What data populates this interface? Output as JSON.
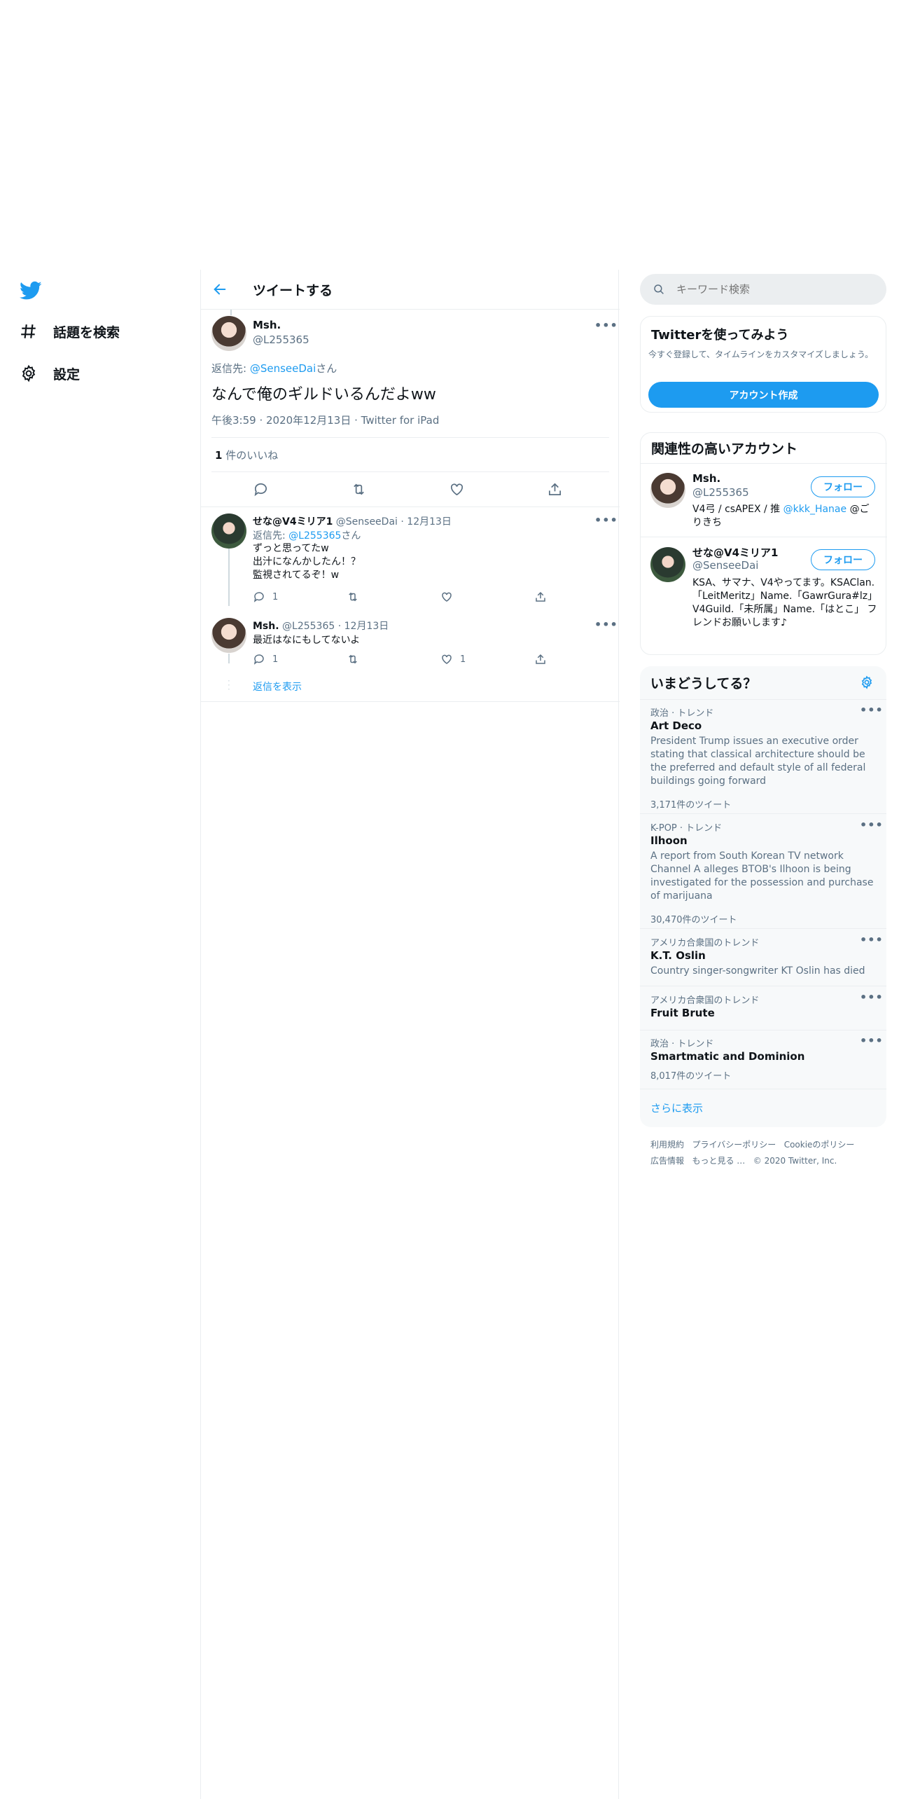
{
  "nav": {
    "items": [
      {
        "label": "話題を検索",
        "icon": "hashtag-icon"
      },
      {
        "label": "設定",
        "icon": "gear-icon"
      }
    ]
  },
  "header": {
    "title": "ツイートする"
  },
  "main_tweet": {
    "name": "Msh.",
    "handle": "@L255365",
    "reply_prefix": "返信先: ",
    "reply_to": "@SenseeDai",
    "reply_suffix": "さん",
    "text": "なんで俺のギルドいるんだよww",
    "time": "午後3:59",
    "date": "2020年12月13日",
    "source": "Twitter for iPad",
    "likes_count": "1",
    "likes_label": "件のいいね"
  },
  "replies": [
    {
      "name": "せな@V4ミリア1",
      "handle": "@SenseeDai",
      "date": "12月13日",
      "reply_prefix": "返信先: ",
      "reply_to": "@L255365",
      "reply_suffix": "さん",
      "lines": [
        "ずっと思ってたw",
        "出汁になんかしたん！？",
        "監視されてるぞ！w"
      ],
      "reply_count": "1",
      "like_count": ""
    },
    {
      "name": "Msh.",
      "handle": "@L255365",
      "date": "12月13日",
      "lines": [
        "最近はなにもしてないよ"
      ],
      "reply_count": "1",
      "like_count": "1"
    }
  ],
  "show_replies": "返信を表示",
  "search": {
    "placeholder": "キーワード検索"
  },
  "signup": {
    "title": "Twitterを使ってみよう",
    "subtitle": "今すぐ登録して、タイムラインをカスタマイズしましょう。",
    "button": "アカウント作成"
  },
  "related": {
    "title": "関連性の高いアカウント",
    "accounts": [
      {
        "name": "Msh.",
        "handle": "@L255365",
        "follow": "フォロー",
        "bio_a": "V4弓 / csAPEX / 推 ",
        "bio_link": "@kkk_Hanae",
        "bio_b": " @ごりきち"
      },
      {
        "name": "せな@V4ミリア1",
        "handle": "@SenseeDai",
        "follow": "フォロー",
        "bio": "KSA、サマナ、V4やってます。KSAClan.「LeitMeritz」Name.「GawrGura#lz」 V4Guild.「未所属」Name.「はとこ」 フレンドお願いします♪"
      }
    ]
  },
  "trends": {
    "title": "いまどうしてる？",
    "items": [
      {
        "meta": "政治 · トレンド",
        "name": "Art Deco",
        "desc": "President Trump issues an executive order stating that classical architecture should be the preferred and default style of all federal buildings going forward",
        "count": "3,171件のツイート"
      },
      {
        "meta": "K-POP · トレンド",
        "name": "Ilhoon",
        "desc": "A report from South Korean TV network Channel A alleges BTOB's Ilhoon is being investigated for the possession and purchase of marijuana",
        "count": "30,470件のツイート"
      },
      {
        "meta": "アメリカ合衆国のトレンド",
        "name": "K.T. Oslin",
        "desc": "Country singer-songwriter KT Oslin has died",
        "count": ""
      },
      {
        "meta": "アメリカ合衆国のトレンド",
        "name": "Fruit Brute",
        "desc": "",
        "count": ""
      },
      {
        "meta": "政治 · トレンド",
        "name": "Smartmatic and Dominion",
        "desc": "",
        "count": "8,017件のツイート"
      }
    ],
    "show_more": "さらに表示"
  },
  "footer": {
    "links": [
      "利用規約",
      "プライバシーポリシー",
      "Cookieのポリシー",
      "広告情報",
      "もっと見る …"
    ],
    "copyright": "© 2020 Twitter, Inc."
  },
  "colors": {
    "accent": "#1d9bf0",
    "text": "#0f1419",
    "secondary": "#5b7083",
    "border": "#ebeef0"
  }
}
